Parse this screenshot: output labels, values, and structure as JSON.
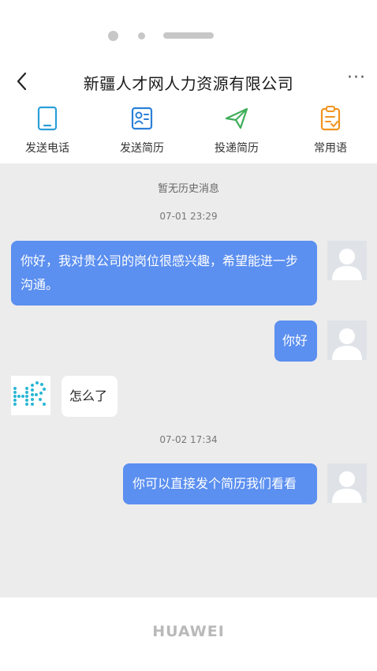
{
  "header": {
    "title": "新疆人才网人力资源有限公司",
    "more": "···"
  },
  "actions": [
    {
      "label": "发送电话",
      "icon": "phone-icon",
      "color": "#2a9fd8"
    },
    {
      "label": "发送简历",
      "icon": "resume-icon",
      "color": "#2a7fd8"
    },
    {
      "label": "投递简历",
      "icon": "send-icon",
      "color": "#3fae5a"
    },
    {
      "label": "常用语",
      "icon": "clipboard-icon",
      "color": "#f0941f"
    }
  ],
  "chat": {
    "history_notice": "暂无历史消息",
    "messages": [
      {
        "type": "time",
        "text": "07-01 23:29"
      },
      {
        "type": "sent",
        "text": "你好，我对贵公司的岗位很感兴趣，希望能进一步沟通。"
      },
      {
        "type": "sent",
        "text": "你好"
      },
      {
        "type": "received",
        "text": "怎么了"
      },
      {
        "type": "time",
        "text": "07-02 17:34"
      },
      {
        "type": "sent",
        "text": "你可以直接发个简历我们看看"
      }
    ]
  },
  "device": {
    "brand": "HUAWEI"
  },
  "colors": {
    "bubble_sent": "#5b8ff0",
    "chat_background": "#ececec"
  }
}
